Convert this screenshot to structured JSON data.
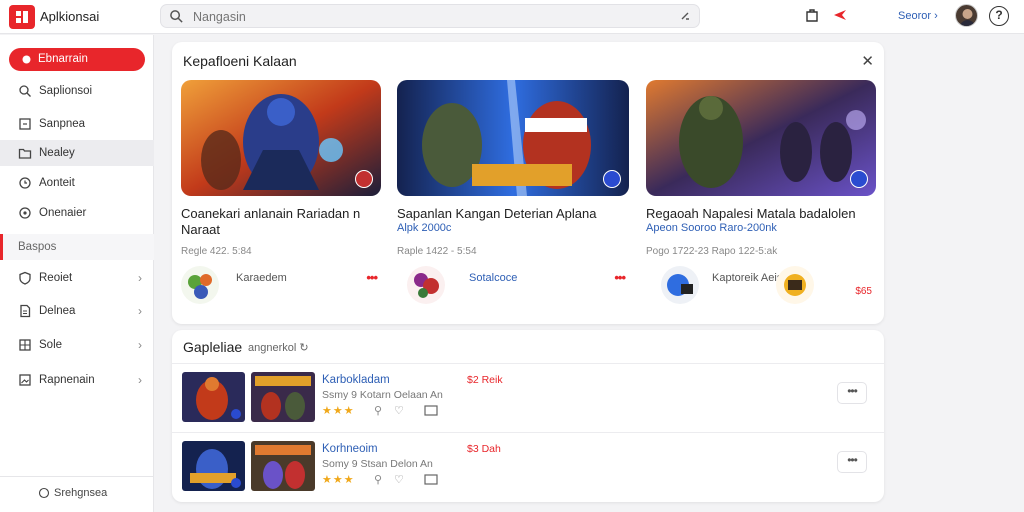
{
  "app": {
    "title": "Aplkionsai"
  },
  "search": {
    "placeholder": "Nangasin"
  },
  "header": {
    "user_name": "Seoror",
    "help_label": "?"
  },
  "sidebar": {
    "active_label": "Ebnarrain",
    "items": [
      {
        "label": "Saplionsoi",
        "icon": "search-icon"
      },
      {
        "label": "Sanpnea",
        "icon": "square-icon"
      },
      {
        "label": "Nealey",
        "icon": "folder-icon"
      },
      {
        "label": "Aonteit",
        "icon": "clock-icon"
      },
      {
        "label": "Onenaier",
        "icon": "target-icon"
      },
      {
        "label": "Baspos",
        "icon": ""
      },
      {
        "label": "Reoiet",
        "icon": "shield-icon"
      },
      {
        "label": "Delnea",
        "icon": "document-icon"
      },
      {
        "label": "Sole",
        "icon": "grid-icon"
      },
      {
        "label": "Rapnenain",
        "icon": "image-icon"
      }
    ],
    "footer_label": "Srehgnsea"
  },
  "featured": {
    "title": "Kepafloeni Kalaan",
    "cards": [
      {
        "title": "Coanekari anlanain Rariadan  n Naraat",
        "subtitle": "",
        "meta": "Regle 422. 5:84",
        "footer_label": "Karaedem",
        "more": "•••",
        "price": "",
        "colors": [
          "#1b1e3a",
          "#c23a1a",
          "#f07a2a",
          "#3a6fd8"
        ]
      },
      {
        "title": "Sapanlan Kangan Deterian Aplana",
        "subtitle": "Alpk 2000c",
        "meta": "Raple 1422 - 5:54",
        "footer_label": "Sotalcoce",
        "more": "•••",
        "price": "",
        "colors": [
          "#14224f",
          "#2f6de0",
          "#e2a02a",
          "#b33220"
        ]
      },
      {
        "title": "Regaoah Napalesi    Matala badalolen",
        "subtitle": "Apeon Sooroo    Raro-200nk",
        "meta": "Pogo 1722-23   Rapo 122-5:ak",
        "footer_label": "Kaptoreik   Aeiscator",
        "more": "",
        "price": "$65",
        "colors": [
          "#1e1a38",
          "#6a52c8",
          "#e07a30",
          "#4a8a4a"
        ]
      }
    ]
  },
  "list": {
    "title": "Gapleliae",
    "subtitle": "angnerkol",
    "rows": [
      {
        "title": "Karbokladam",
        "subtitle": "Ssmy 9 Kotarn Oelaan An",
        "price": "$2 Reik",
        "stars": "★★★",
        "more": "•••"
      },
      {
        "title": "Korhneoim",
        "subtitle": "Somy 9 Stsan Delon An",
        "price": "$3 Dah",
        "stars": "★★★",
        "more": "•••"
      }
    ]
  },
  "colors": {
    "accent": "#e8262b",
    "link": "#2e5fb5"
  }
}
